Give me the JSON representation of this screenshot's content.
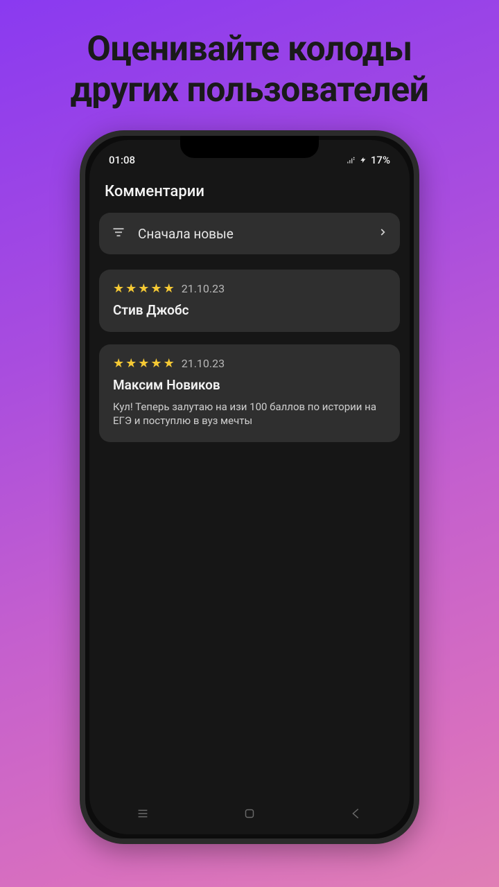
{
  "hero": {
    "line1": "Оценивайте колоды",
    "line2": "других пользователей"
  },
  "status": {
    "time": "01:08",
    "battery_text": "17%"
  },
  "header": {
    "title": "Комментарии"
  },
  "sort": {
    "label": "Сначала новые"
  },
  "comments": [
    {
      "stars": 5,
      "date": "21.10.23",
      "author": "Стив Джобс",
      "body": ""
    },
    {
      "stars": 5,
      "date": "21.10.23",
      "author": "Максим Новиков",
      "body": "Кул! Теперь залутаю на изи 100 баллов по истории на ЕГЭ и поступлю в вуз мечты"
    }
  ],
  "colors": {
    "star": "#f5c934",
    "card_bg": "#2f2f2f",
    "screen_bg": "#161616"
  }
}
